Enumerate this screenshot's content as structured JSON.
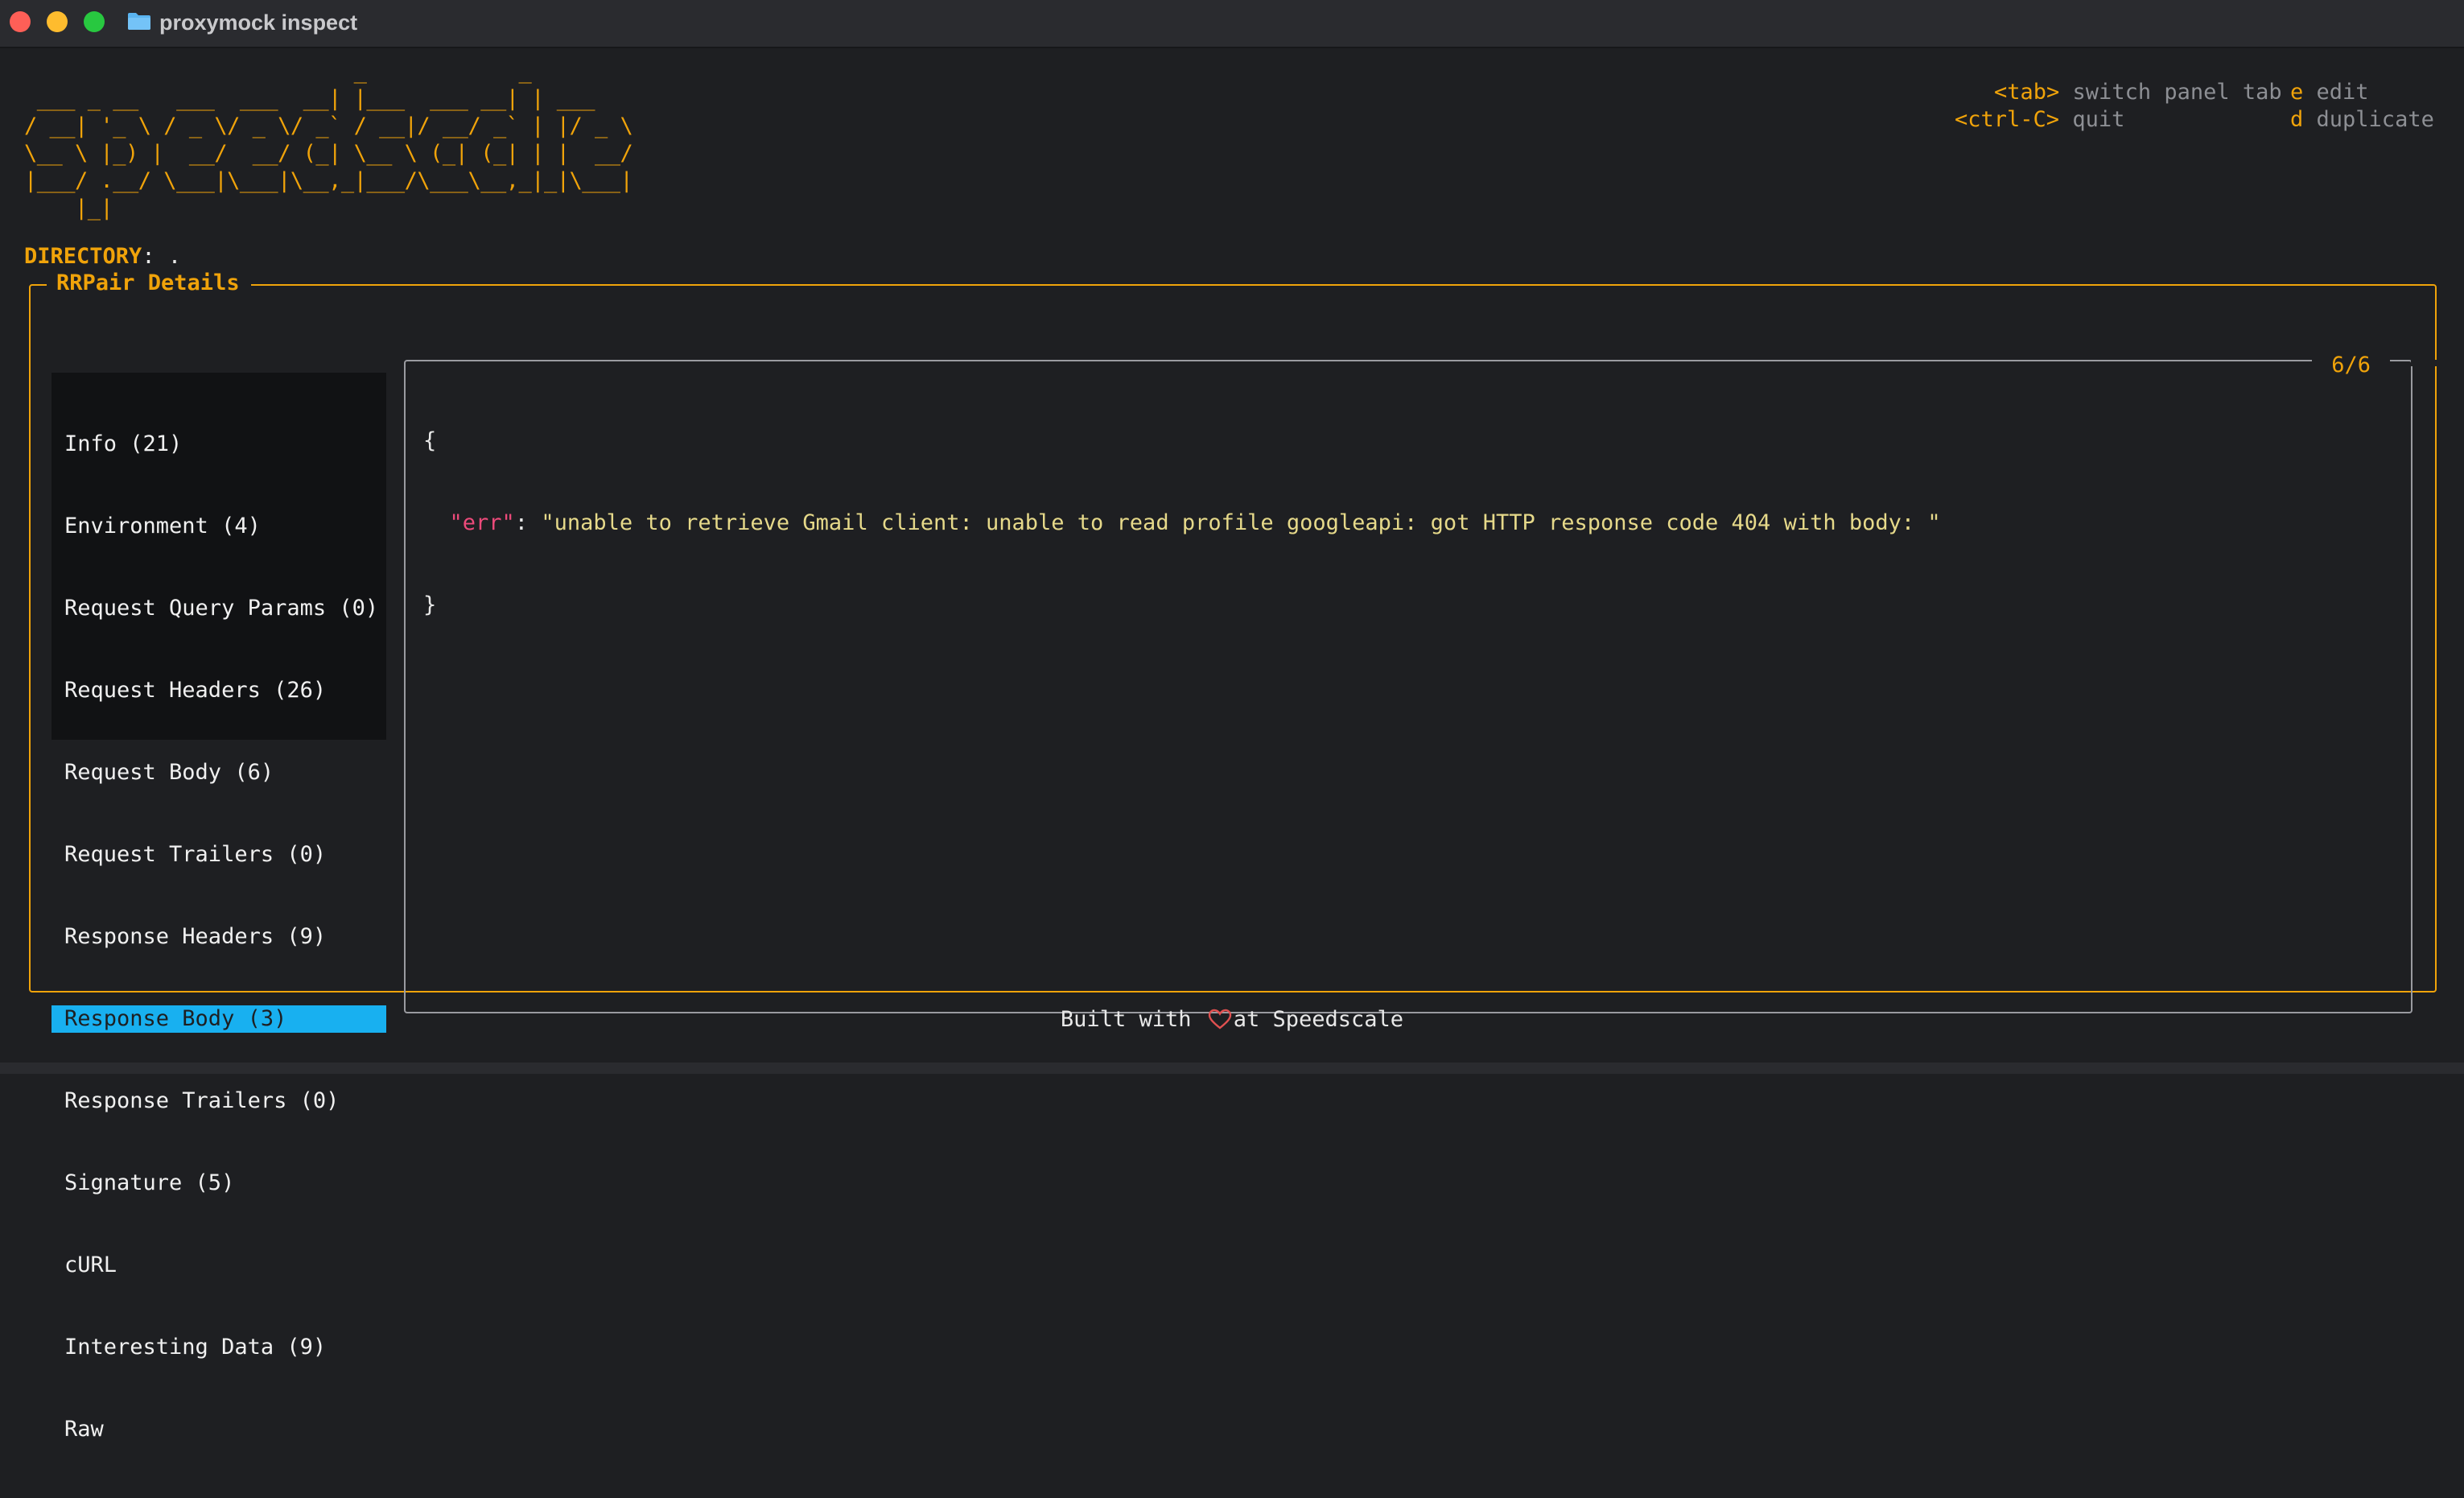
{
  "window": {
    "title": "proxymock inspect"
  },
  "banner": {
    "art_lines": [
      "                          _            _",
      " ___ _ __   ___  ___  __| |___  ___ __| | ___",
      "/ __| '_ \\ / _ \\/ _ \\/ _` / __|/ __/ _` | |/ _ \\",
      "\\__ \\ |_) |  __/  __/ (_| \\__ \\ (_| (_| | |  __/",
      "|___/ .__/ \\___|\\___|\\__,_|___/\\___\\__,_|_|\\___|",
      "    |_|"
    ]
  },
  "help": {
    "items": [
      {
        "key": "<tab>",
        "label": "switch panel tab"
      },
      {
        "key": "<ctrl-C>",
        "label": "quit"
      },
      {
        "key": "e",
        "label": "edit"
      },
      {
        "key": "d",
        "label": "duplicate"
      }
    ]
  },
  "directory": {
    "label": "DIRECTORY",
    "separator": ": ",
    "value": "."
  },
  "panel": {
    "title": "RRPair Details",
    "tabs": [
      {
        "label": "Info (21)",
        "selected": false
      },
      {
        "label": "Environment (4)",
        "selected": false
      },
      {
        "label": "Request Query Params (0)",
        "selected": false
      },
      {
        "label": "Request Headers (26)",
        "selected": false
      },
      {
        "label": "Request Body (6)",
        "selected": false
      },
      {
        "label": "Request Trailers (0)",
        "selected": false
      },
      {
        "label": "Response Headers (9)",
        "selected": false
      },
      {
        "label": "Response Body (3)",
        "selected": true
      },
      {
        "label": "Response Trailers (0)",
        "selected": false
      },
      {
        "label": "Signature (5)",
        "selected": false
      },
      {
        "label": "cURL",
        "selected": false
      },
      {
        "label": "Interesting Data (9)",
        "selected": false
      },
      {
        "label": "Raw",
        "selected": false
      }
    ],
    "counter": "6/6",
    "body": {
      "open": "{",
      "key": "\"err\"",
      "colon": ": ",
      "value": "\"unable to retrieve Gmail client: unable to read profile googleapi: got HTTP response code 404 with body: \"",
      "close": "}"
    }
  },
  "footer": {
    "prefix": "Built with ",
    "icon": "heart-icon",
    "suffix": "at Speedscale"
  },
  "colors": {
    "accent": "#f0a30a",
    "selection": "#18b0f0",
    "json_key": "#ec4a7a",
    "json_string": "#e6d98a",
    "heart": "#e05050"
  }
}
